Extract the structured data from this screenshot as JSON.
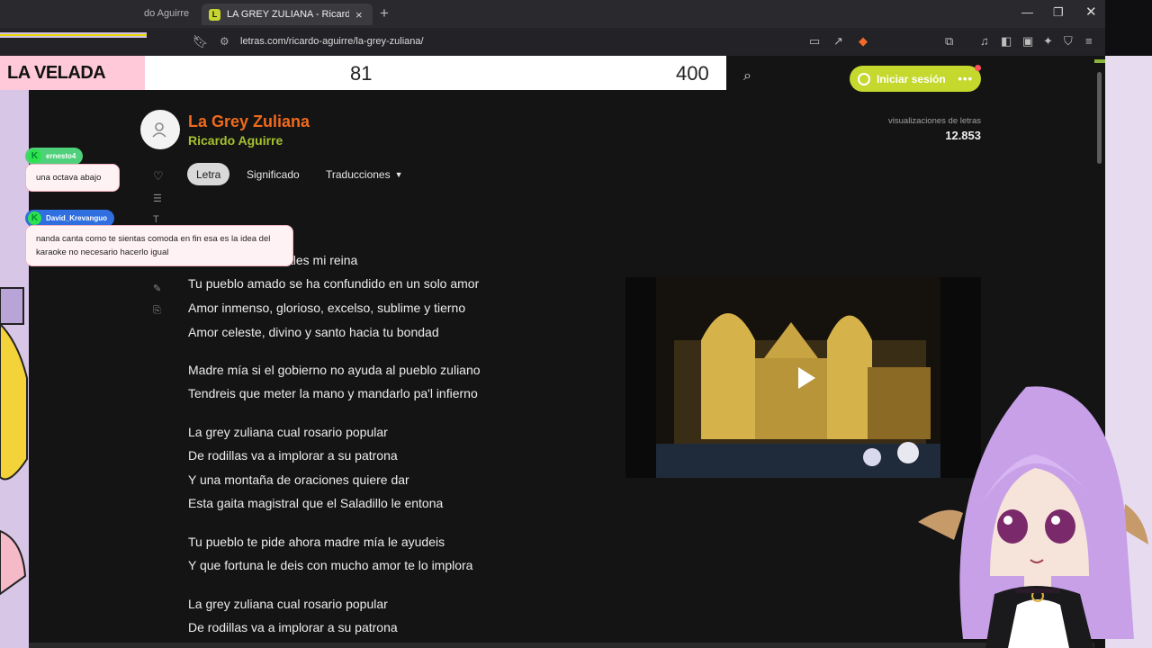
{
  "browser": {
    "prev_tab_title": "do Aguirre",
    "active_tab_title": "LA GREY ZULIANA - Ricardo Aguirre",
    "active_tab_favicon": "L",
    "url": "letras.com/ricardo-aguirre/la-grey-zuliana/"
  },
  "stream_overlay": {
    "banner": "LA VELADA",
    "score_left": "81",
    "score_right": "400"
  },
  "chat": [
    {
      "user": "ernesto4",
      "message": "una octava abajo",
      "name_color": "#4fd07a"
    },
    {
      "user": "David_Krevanguo",
      "message": "nanda canta como te sientas comoda en fin esa es la idea del karaoke no necesario hacerlo igual",
      "name_color": "#2f6fe0"
    }
  ],
  "site": {
    "login_label": "Iniciar sesión",
    "views_label": "visualizaciones de letras",
    "views_count": "12.853",
    "accent_color": "#c4d82e"
  },
  "song": {
    "title": "La Grey Zuliana",
    "artist": "Ricardo Aguirre",
    "title_color": "#f06a1c",
    "artist_color": "#a5c030"
  },
  "tabs": [
    {
      "label": "Letra"
    },
    {
      "label": "Significado"
    },
    {
      "label": "Traducciones"
    }
  ],
  "lyrics": [
    "uando a la calle sales mi reina",
    "Tu pueblo amado se ha confundido en un solo amor",
    "Amor inmenso, glorioso, excelso, sublime y tierno",
    "Amor celeste, divino y santo hacia tu bondad",
    "Madre mía si el gobierno no ayuda al pueblo zuliano",
    "Tendreis que meter la mano y mandarlo pa'l infierno",
    "La grey zuliana cual rosario popular",
    "De rodillas va a implorar a su patrona",
    "Y una montaña de oraciones quiere dar",
    "Esta gaita magistral que el Saladillo le entona",
    "Tu pueblo te pide ahora madre mía le ayudeis",
    "Y que fortuna le deis con mucho amor te lo implora",
    "La grey zuliana cual rosario popular",
    "De rodillas va a implorar a su patrona"
  ],
  "icons": {
    "favorite": "heart-icon",
    "playlist": "add-to-playlist-icon",
    "edit": "edit-icon",
    "share": "share-icon",
    "video_play": "play-icon"
  }
}
